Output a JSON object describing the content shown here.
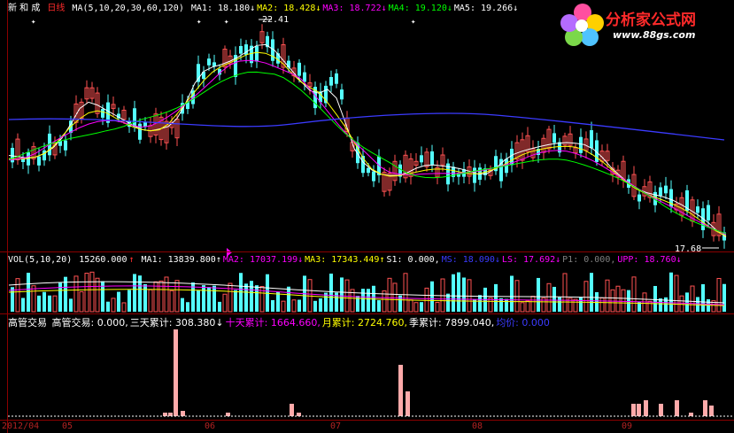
{
  "header": {
    "stock": "新 和 成",
    "period": "日线",
    "ma_params": "MA(5,10,20,30,60,120)",
    "ma_items": [
      {
        "label": "MA1:",
        "value": "18.180",
        "arrow": "↓",
        "color": "#ffffff"
      },
      {
        "label": "MA2:",
        "value": "18.428",
        "arrow": "↓",
        "color": "#ffff00"
      },
      {
        "label": "MA3:",
        "value": "18.722",
        "arrow": "↓",
        "color": "#ff00ff"
      },
      {
        "label": "MA4:",
        "value": "19.120",
        "arrow": "↓",
        "color": "#00ff00"
      },
      {
        "label": "MA5:",
        "value": "19.266",
        "arrow": "↓",
        "color": "#ffffff"
      }
    ]
  },
  "price_annotations": {
    "high": "22.41",
    "low": "17.68"
  },
  "volume": {
    "params": "VOL(5,10,20)",
    "vol_value": "15260.000",
    "vol_arrow": "↑",
    "items": [
      {
        "label": "MA1:",
        "value": "13839.800",
        "arrow": "↑",
        "color": "#ffffff"
      },
      {
        "label": "MA2:",
        "value": "17037.199",
        "arrow": "↓",
        "color": "#ff00ff"
      },
      {
        "label": "MA3:",
        "value": "17343.449",
        "arrow": "↑",
        "color": "#ffff00"
      },
      {
        "label": "S1:",
        "value": "0.000,",
        "arrow": "",
        "color": "#ffffff"
      },
      {
        "label": "MS:",
        "value": "18.090",
        "arrow": "↓",
        "color": "#3b3bff"
      },
      {
        "label": "LS:",
        "value": "17.692",
        "arrow": "↓",
        "color": "#ff00ff"
      },
      {
        "label": "P1:",
        "value": "0.000,",
        "arrow": "",
        "color": "#808080"
      },
      {
        "label": "UPP:",
        "value": "18.760",
        "arrow": "↓",
        "color": "#ff00ff"
      }
    ]
  },
  "exec": {
    "title": "高管交易",
    "items": [
      {
        "label": "高管交易:",
        "value": "0.000,",
        "arrow": "",
        "color": "#ffffff"
      },
      {
        "label": "三天累计:",
        "value": "308.380",
        "arrow": "↓",
        "color": "#ffffff"
      },
      {
        "label": "十天累计:",
        "value": "1664.660,",
        "arrow": "",
        "color": "#ff00ff"
      },
      {
        "label": "月累计:",
        "value": "2724.760,",
        "arrow": "",
        "color": "#ffff00"
      },
      {
        "label": "季累计:",
        "value": "7899.040,",
        "arrow": "",
        "color": "#ffffff"
      },
      {
        "label": "均价:",
        "value": "0.000",
        "arrow": "",
        "color": "#3b3bff"
      }
    ]
  },
  "x_axis": [
    "2012/04",
    "05",
    "06",
    "07",
    "08",
    "09"
  ],
  "logo": {
    "title": "分析家公式网",
    "url": "www.88gs.com"
  },
  "colors": {
    "up": "#ff5252",
    "down": "#54ffff",
    "axis": "#8b0000",
    "exec_bar": "#ffaaaa"
  }
}
